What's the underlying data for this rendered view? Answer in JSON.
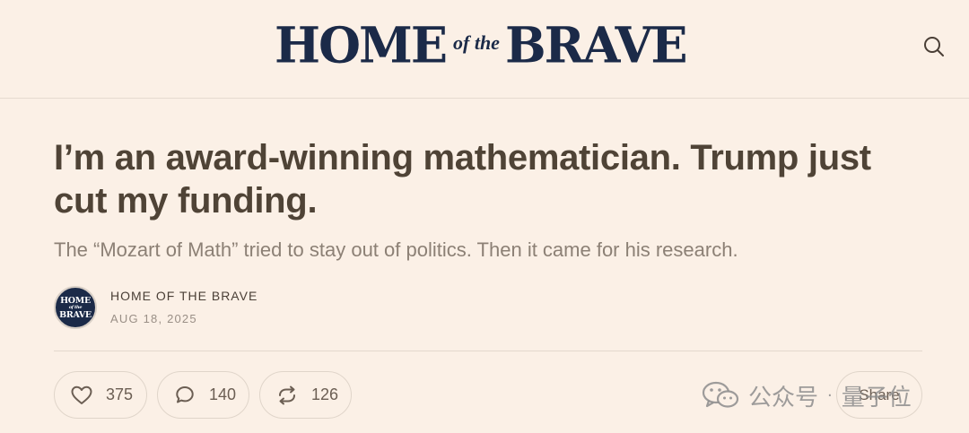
{
  "header": {
    "logo": {
      "word_left": "HOME",
      "word_middle": "of the",
      "word_right": "BRAVE"
    },
    "search_icon": "search-icon"
  },
  "article": {
    "title": "I’m an award-winning mathematician. Trump just cut my funding.",
    "subtitle": "The “Mozart of Math” tried to stay out of politics. Then it came for his research.",
    "author": "HOME OF THE BRAVE",
    "date": "AUG 18, 2025",
    "avatar": {
      "line1": "HOME",
      "line2": "of the",
      "line3": "BRAVE"
    }
  },
  "actions": {
    "likes": "375",
    "comments": "140",
    "restacks": "126",
    "share_label": "Share",
    "icons": [
      "heart-icon",
      "comment-icon",
      "restack-icon"
    ]
  },
  "watermark": {
    "text_left": "公众号",
    "separator": "·",
    "text_right": "量子位",
    "icon": "wechat-icon"
  },
  "colors": {
    "background": "#fbf0e6",
    "brand_navy": "#1b2a48",
    "title": "#4f4336",
    "muted": "#8c8075"
  }
}
